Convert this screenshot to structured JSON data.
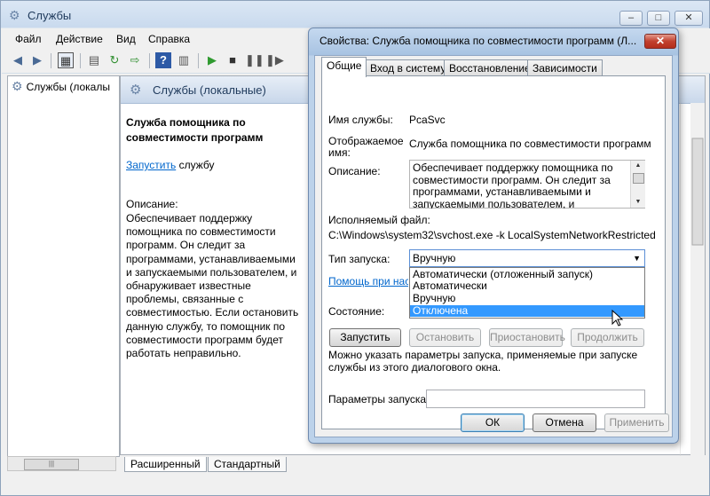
{
  "main_window": {
    "title": "Службы",
    "controls": {
      "minimize": "–",
      "maximize": "□",
      "close": "✕"
    }
  },
  "menu": [
    "Файл",
    "Действие",
    "Вид",
    "Справка"
  ],
  "tree": {
    "root_label": "Службы (локалы"
  },
  "details": {
    "header_title": "Службы (локальные)",
    "service_name": "Служба помощника по совместимости программ",
    "start_link": "Запустить",
    "start_suffix": " службу",
    "description_label": "Описание:",
    "description": "Обеспечивает поддержку помощника по совместимости программ. Он следит за программами, устанавливаемыми и запускаемыми пользователем, и обнаруживает известные проблемы, связанные с совместимостью. Если остановить данную службу, то помощник по совместимости программ будет работать неправильно."
  },
  "bottom_tabs": [
    "Расширенный",
    "Стандартный"
  ],
  "hscroll_thumb": "|||",
  "dialog": {
    "title": "Свойства: Служба помощника по совместимости программ (Л...",
    "close": "✕",
    "tabs": [
      "Общие",
      "Вход в систему",
      "Восстановление",
      "Зависимости"
    ],
    "service_name_label": "Имя службы:",
    "service_name_value": "PcaSvc",
    "display_name_label_1": "Отображаемое",
    "display_name_label_2": "имя:",
    "display_name_value": "Служба помощника по совместимости программ",
    "description_label": "Описание:",
    "description_value": "Обеспечивает поддержку помощника по совместимости программ. Он следит за программами, устанавливаемыми и запускаемыми пользователем, и обнаруживает",
    "exe_label": "Исполняемый файл:",
    "exe_value": "C:\\Windows\\system32\\svchost.exe -k LocalSystemNetworkRestricted",
    "startup_type_label": "Тип запуска:",
    "startup_type_value": "Вручную",
    "startup_options": [
      "Автоматически (отложенный запуск)",
      "Автоматически",
      "Вручную",
      "Отключена"
    ],
    "startup_highlighted": "Отключена",
    "help_link": "Помощь при настройке параметров запуска",
    "state_label": "Состояние:",
    "buttons": {
      "start": "Запустить",
      "stop": "Остановить",
      "pause": "Приостановить",
      "resume": "Продолжить"
    },
    "params_note": "Можно указать параметры запуска, применяемые при запуске службы из этого диалогового окна.",
    "params_label": "Параметры запуска:",
    "params_value": "",
    "ok": "ОК",
    "cancel": "Отмена",
    "apply": "Применить"
  }
}
